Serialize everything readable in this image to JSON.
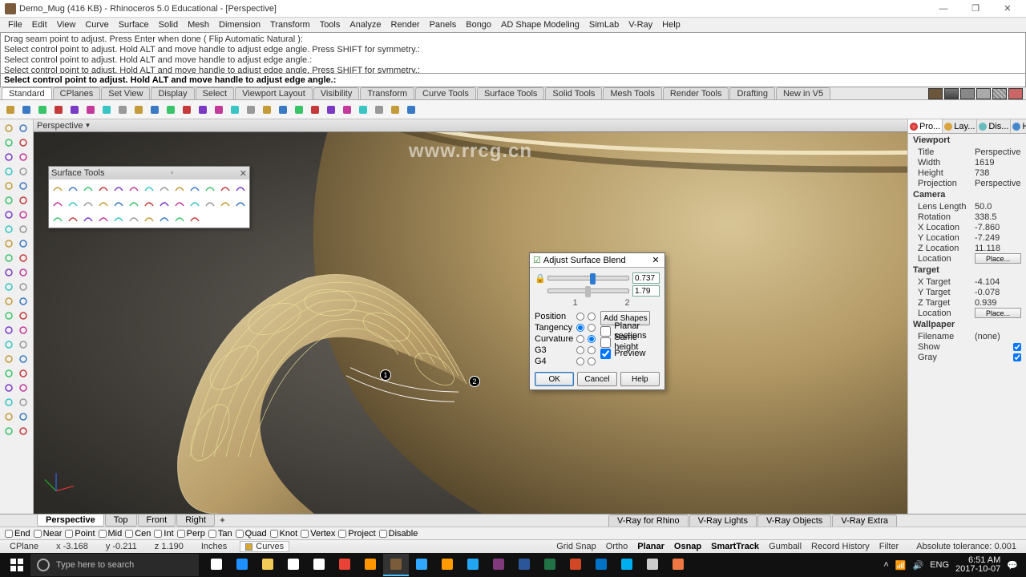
{
  "window": {
    "title": "Demo_Mug (416 KB) - Rhinoceros 5.0 Educational - [Perspective]"
  },
  "menu": [
    "File",
    "Edit",
    "View",
    "Curve",
    "Surface",
    "Solid",
    "Mesh",
    "Dimension",
    "Transform",
    "Tools",
    "Analyze",
    "Render",
    "Panels",
    "Bongo",
    "AD Shape Modeling",
    "SimLab",
    "V-Ray",
    "Help"
  ],
  "cmd_history": [
    "Drag seam point to adjust. Press Enter when done ( Flip  Automatic  Natural ):",
    "Select control point to adjust. Hold ALT and move handle to adjust edge angle. Press SHIFT for symmetry.:",
    "Select control point to adjust. Hold ALT and move handle to adjust edge angle.:",
    "Select control point to adjust. Hold ALT and move handle to adjust edge angle. Press SHIFT for symmetry.:"
  ],
  "cmd_prompt": "Select control point to adjust. Hold ALT and move handle to adjust edge angle.:",
  "tool_tabs": [
    "Standard",
    "CPlanes",
    "Set View",
    "Display",
    "Select",
    "Viewport Layout",
    "Visibility",
    "Transform",
    "Curve Tools",
    "Surface Tools",
    "Solid Tools",
    "Mesh Tools",
    "Render Tools",
    "Drafting",
    "New in V5"
  ],
  "viewport_label": "Perspective",
  "float_toolbox_title": "Surface Tools",
  "dialog": {
    "title": "Adjust Surface Blend",
    "slider1_value": "0.737",
    "slider2_value": "1.79",
    "marker1": "1",
    "marker2": "2",
    "rows": [
      "Position",
      "Tangency",
      "Curvature",
      "G3",
      "G4"
    ],
    "add_shapes": "Add Shapes",
    "chk_planar": "Planar sections",
    "chk_sameheight": "Same height",
    "chk_preview": "Preview",
    "ok": "OK",
    "cancel": "Cancel",
    "help": "Help"
  },
  "right_tabs": [
    "Pro...",
    "Lay...",
    "Dis...",
    "Help"
  ],
  "props": {
    "viewport": {
      "Title": "Perspective",
      "Width": "1619",
      "Height": "738",
      "Projection": "Perspective"
    },
    "camera": {
      "Lens Length": "50.0",
      "Rotation": "338.5",
      "X Location": "-7.860",
      "Y Location": "-7.249",
      "Z Location": "11.118"
    },
    "camera_place": "Place...",
    "target": {
      "X Target": "-4.104",
      "Y Target": "-0.078",
      "Z Target": "0.939"
    },
    "target_place": "Place...",
    "wallpaper": {
      "Filename": "(none)",
      "Show": true,
      "Gray": true
    }
  },
  "view_tabs": [
    "Perspective",
    "Top",
    "Front",
    "Right"
  ],
  "vray_tabs": [
    "V-Ray for Rhino",
    "V-Ray Lights",
    "V-Ray Objects",
    "V-Ray Extra"
  ],
  "filters": [
    "End",
    "Near",
    "Point",
    "Mid",
    "Cen",
    "Int",
    "Perp",
    "Tan",
    "Quad",
    "Knot",
    "Vertex",
    "Project",
    "Disable"
  ],
  "status": {
    "cplane": "CPlane",
    "x": "x -3.168",
    "y": "y -0.211",
    "z": "z 1.190",
    "units": "Inches",
    "layer": "Curves",
    "snaps": [
      "Grid Snap",
      "Ortho",
      "Planar",
      "Osnap",
      "SmartTrack",
      "Gumball",
      "Record History",
      "Filter"
    ],
    "tol": "Absolute tolerance: 0.001"
  },
  "taskbar": {
    "search_placeholder": "Type here to search",
    "lang": "ENG",
    "time": "6:51 AM",
    "date": "2017-10-07"
  },
  "watermarks": {
    "url": "www.rrcg.cn"
  },
  "handle1": "1",
  "handle2": "2"
}
